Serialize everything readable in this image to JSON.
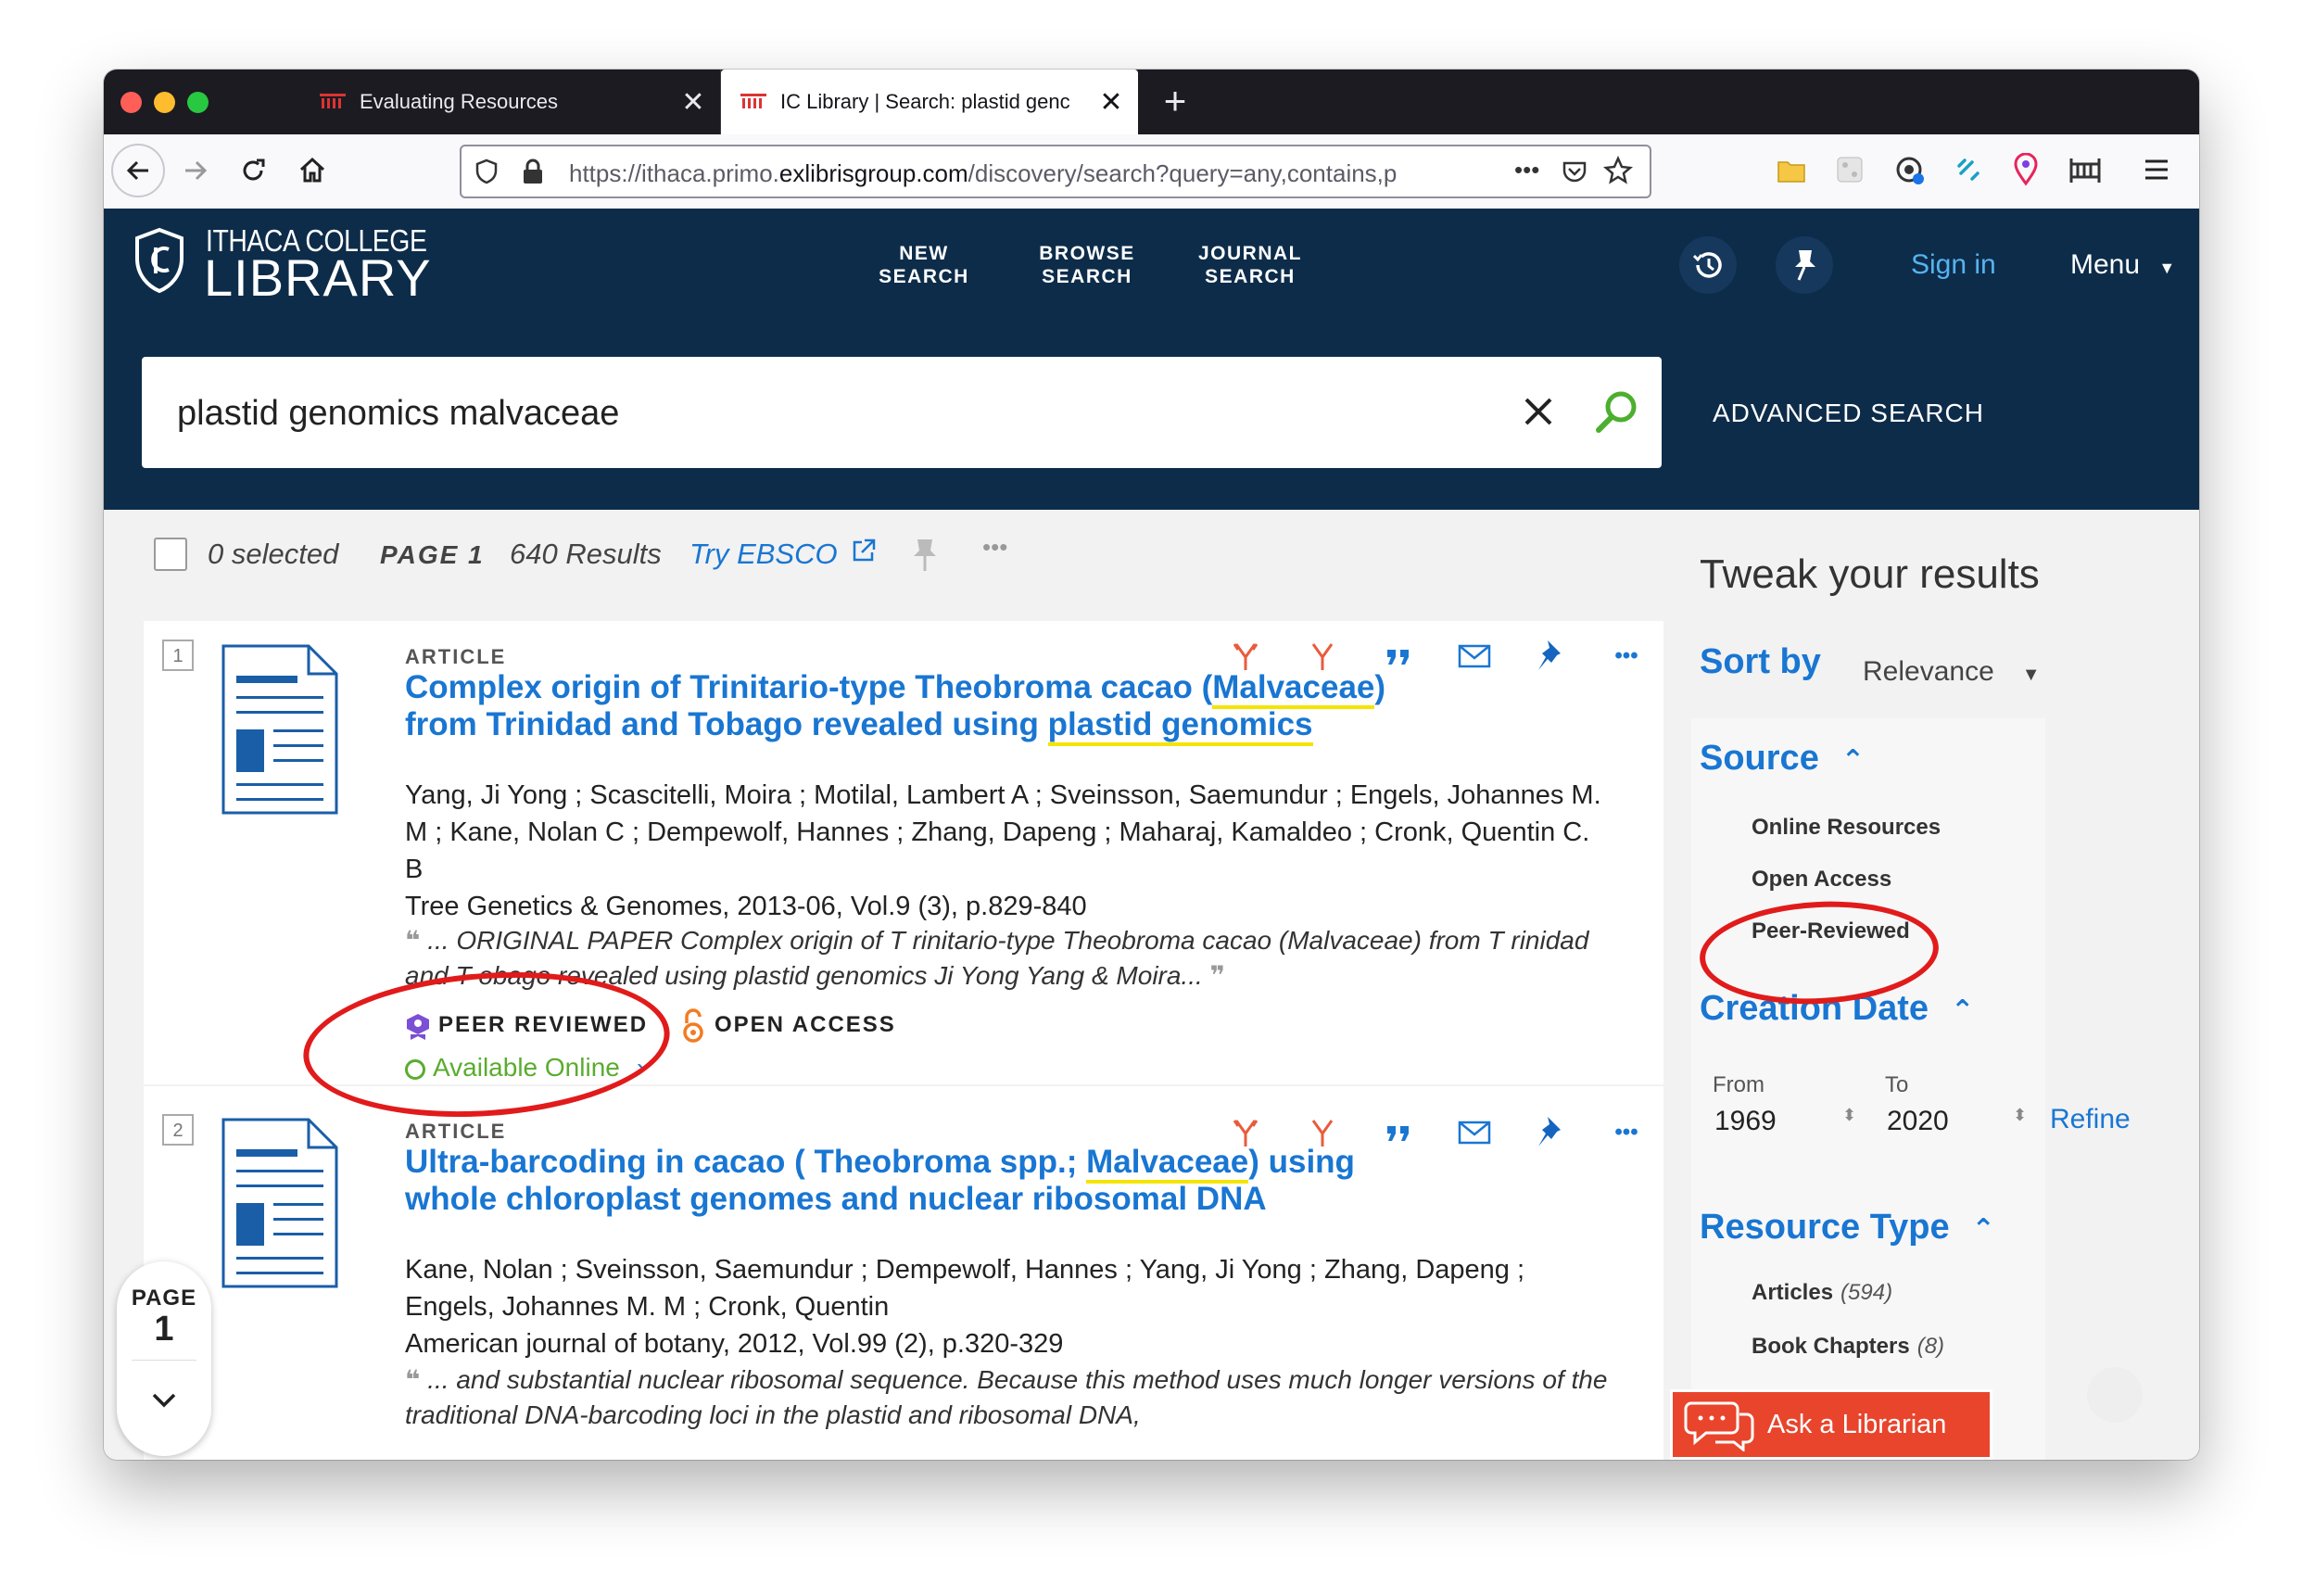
{
  "browser": {
    "tabs": [
      {
        "label": "Evaluating Resources",
        "active": false
      },
      {
        "label": "IC Library | Search: plastid genc",
        "active": true
      }
    ],
    "new_tab": "+",
    "url_prefix": "https://ithaca.primo.",
    "url_domain": "exlibrisgroup.com",
    "url_rest": "/discovery/search?query=any,contains,p",
    "url_more": "•••"
  },
  "library": {
    "logo_line1": "ITHACA COLLEGE",
    "logo_line2": "LIBRARY",
    "nav": [
      "NEW\nSEARCH",
      "BROWSE\nSEARCH",
      "JOURNAL\nSEARCH"
    ],
    "sign_in": "Sign in",
    "menu": "Menu"
  },
  "search": {
    "query": "plastid genomics malvaceae",
    "advanced": "ADVANCED SEARCH"
  },
  "toolbar": {
    "selected": "0 selected",
    "page": "PAGE 1",
    "results": "640 Results",
    "try_ebsco": "Try EBSCO",
    "more": "•••"
  },
  "results": [
    {
      "num": "1",
      "type": "ARTICLE",
      "title_a": "Complex origin of Trinitario-type Theobroma cacao (",
      "title_hl1": "Malvaceae",
      "title_b": ") from Trinidad and Tobago revealed using ",
      "title_hl2": "plastid genomics",
      "authors": "Yang, Ji Yong ; Scascitelli, Moira ; Motilal, Lambert A ; Sveinsson, Saemundur ; Engels, Johannes M. M ; Kane, Nolan C ; Dempewolf, Hannes ; Zhang, Dapeng ; Maharaj, Kamaldeo ; Cronk, Quentin C. B",
      "source": "Tree Genetics & Genomes, 2013-06, Vol.9 (3), p.829-840",
      "snippet": "... ORIGINAL PAPER Complex origin of T rinitario-type Theobroma cacao (Malvaceae) from T rinidad and T obago revealed using plastid genomics Ji Yong Yang & Moira...",
      "peer_reviewed": "PEER REVIEWED",
      "open_access": "OPEN ACCESS",
      "availability": "Available Online"
    },
    {
      "num": "2",
      "type": "ARTICLE",
      "title_a": "Ultra-barcoding in cacao ( Theobroma spp.; ",
      "title_hl1": "Malvaceae",
      "title_b": ") using whole chloroplast genomes and nuclear ribosomal DNA",
      "authors": "Kane, Nolan ; Sveinsson, Saemundur ; Dempewolf, Hannes ; Yang, Ji Yong ; Zhang, Dapeng ; Engels, Johannes M. M ; Cronk, Quentin",
      "source": "American journal of botany, 2012, Vol.99 (2), p.320-329",
      "snippet": "... and substantial nuclear ribosomal sequence. Because this method uses much longer versions of the traditional DNA-barcoding loci in the plastid and ribosomal DNA,"
    }
  ],
  "page_indicator": {
    "label": "PAGE",
    "num": "1"
  },
  "sidebar": {
    "title": "Tweak your results",
    "sort_label": "Sort by",
    "sort_value": "Relevance",
    "source_label": "Source",
    "source_items": [
      "Online Resources",
      "Open Access",
      "Peer-Reviewed"
    ],
    "creation_label": "Creation Date",
    "from_label": "From",
    "to_label": "To",
    "from_value": "1969",
    "to_value": "2020",
    "refine": "Refine",
    "resource_label": "Resource Type",
    "resource_items": [
      {
        "label": "Articles",
        "count": "(594)"
      },
      {
        "label": "Book Chapters",
        "count": "(8)"
      }
    ]
  },
  "ask_librarian": "Ask a Librarian",
  "colors": {
    "header_bg": "#0d2c4a",
    "link_blue": "#1976d2",
    "annotation_red": "#e11b1b",
    "ask_red": "#e8452c",
    "highlight": "#f4e400"
  }
}
